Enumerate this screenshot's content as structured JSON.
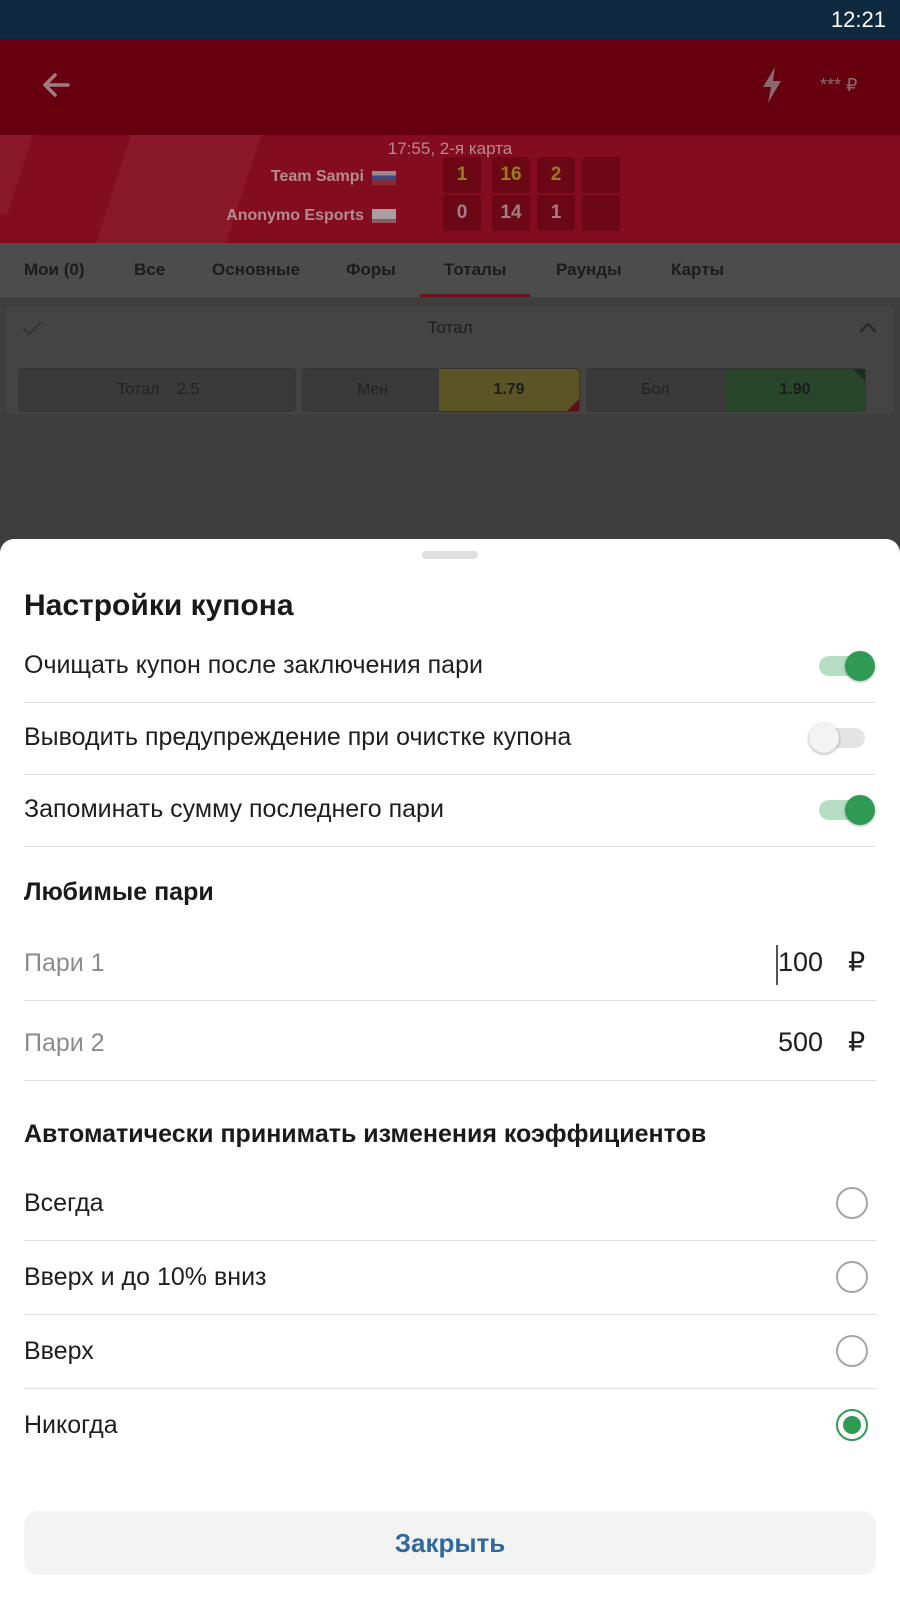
{
  "status_bar": {
    "time": "12:21"
  },
  "app_bar": {
    "balance": "*** ₽",
    "icons": [
      "back-arrow-icon",
      "lightning-icon"
    ]
  },
  "match": {
    "info": "17:55, 2-я карта",
    "team1": {
      "name": "Team Sampi",
      "scores": [
        "1",
        "16",
        "2"
      ]
    },
    "team2": {
      "name": "Anonymo Esports",
      "scores": [
        "0",
        "14",
        "1"
      ]
    }
  },
  "tabs": [
    {
      "label": "Мои (0)"
    },
    {
      "label": "Все"
    },
    {
      "label": "Основные"
    },
    {
      "label": "Форы"
    },
    {
      "label": "Тоталы",
      "active": true
    },
    {
      "label": "Раунды"
    },
    {
      "label": "Карты"
    }
  ],
  "market": {
    "title": "Тотал",
    "total_label": "Тотал",
    "total_value": "2.5",
    "under_label": "Мен",
    "under_odd": "1.79",
    "over_label": "Бол",
    "over_odd": "1.90"
  },
  "sheet": {
    "title": "Настройки купона",
    "toggles": [
      {
        "label": "Очищать купон после заключения пари",
        "on": true
      },
      {
        "label": "Выводить предупреждение при очистке купона",
        "on": false
      },
      {
        "label": "Запоминать сумму последнего пари",
        "on": true
      }
    ],
    "favorites_title": "Любимые пари",
    "favorites": [
      {
        "label": "Пари 1",
        "amount": "100",
        "currency": "₽"
      },
      {
        "label": "Пари 2",
        "amount": "500",
        "currency": "₽"
      }
    ],
    "odds_change_title": "Автоматически принимать изменения коэффициентов",
    "odds_options": [
      {
        "label": "Всегда",
        "selected": false
      },
      {
        "label": "Вверх и до 10% вниз",
        "selected": false
      },
      {
        "label": "Вверх",
        "selected": false
      },
      {
        "label": "Никогда",
        "selected": true
      }
    ],
    "close_label": "Закрыть"
  },
  "colors": {
    "accent_green": "#2f9a53",
    "link_blue": "#2e6a9e",
    "brand_red": "#c8102e"
  }
}
